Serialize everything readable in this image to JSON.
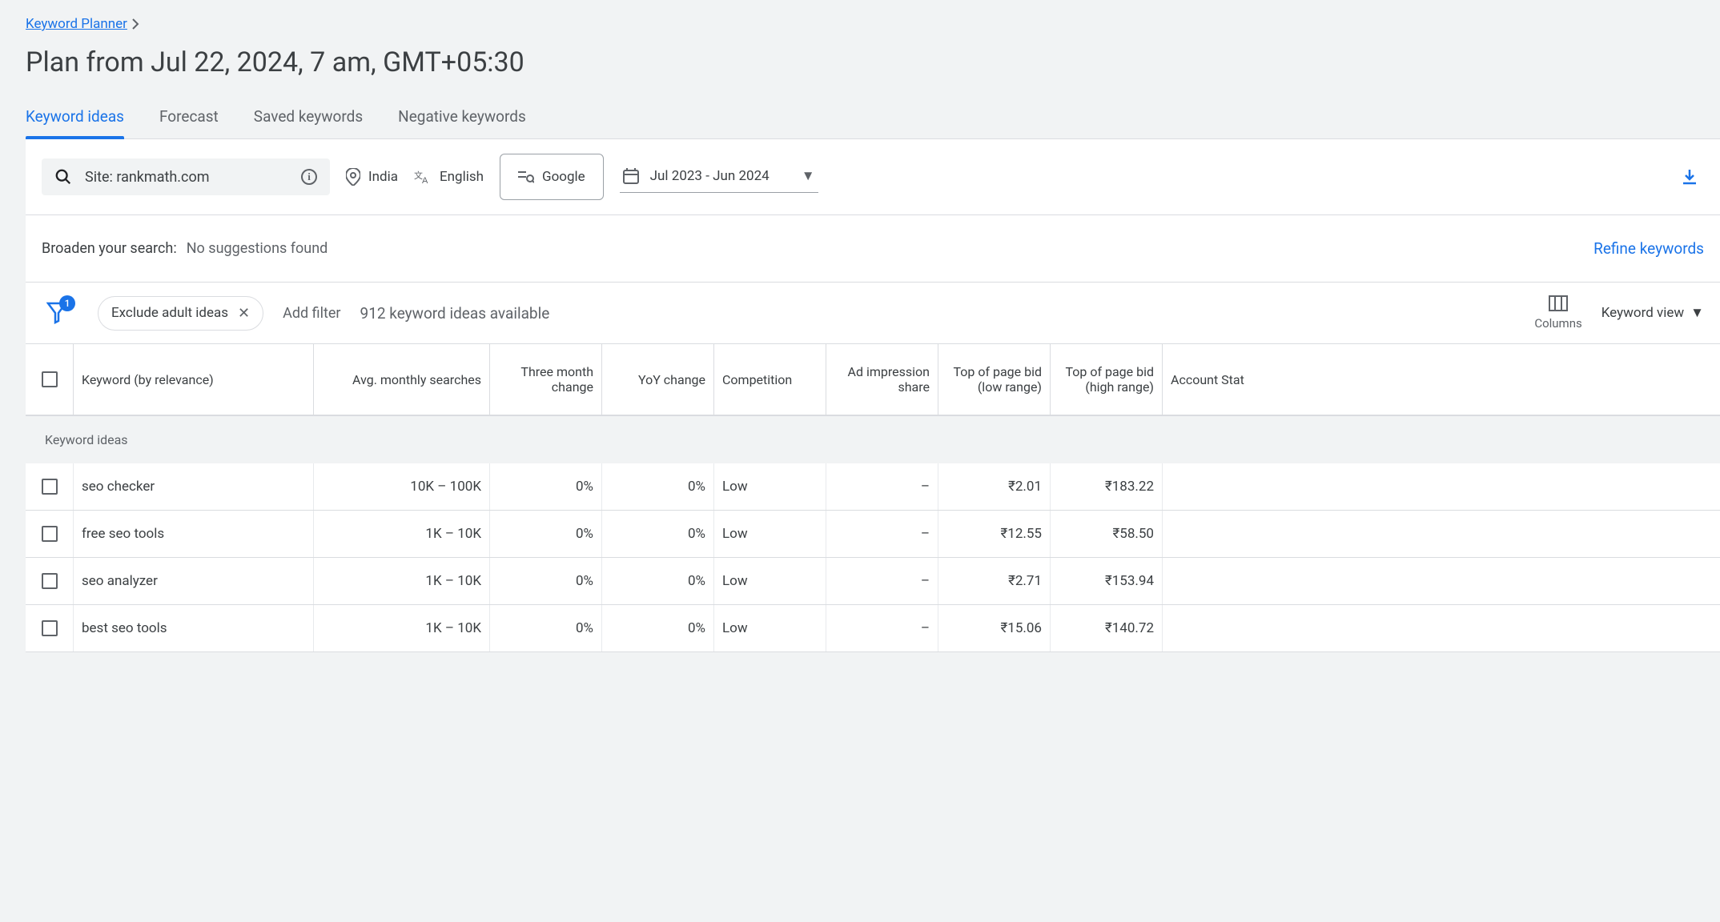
{
  "breadcrumb": {
    "label": "Keyword Planner"
  },
  "page_title": "Plan from Jul 22, 2024, 7 am, GMT+05:30",
  "tabs": [
    {
      "label": "Keyword ideas",
      "active": true
    },
    {
      "label": "Forecast"
    },
    {
      "label": "Saved keywords"
    },
    {
      "label": "Negative keywords"
    }
  ],
  "filters": {
    "site": "Site: rankmath.com",
    "location": "India",
    "language": "English",
    "network": "Google",
    "date_range": "Jul 2023 - Jun 2024"
  },
  "broaden": {
    "label": "Broaden your search:",
    "value": "No suggestions found"
  },
  "refine_label": "Refine keywords",
  "toolbar": {
    "filter_badge": "1",
    "pill_label": "Exclude adult ideas",
    "add_filter": "Add filter",
    "ideas_count": "912 keyword ideas available",
    "columns_label": "Columns",
    "view_label": "Keyword view"
  },
  "columns": {
    "keyword": "Keyword (by relevance)",
    "avg": "Avg. monthly searches",
    "three_month": "Three month change",
    "yoy": "YoY change",
    "competition": "Competition",
    "ad_share": "Ad impression share",
    "bid_low": "Top of page bid (low range)",
    "bid_high": "Top of page bid (high range)",
    "account_stat": "Account Stat"
  },
  "subheader": "Keyword ideas",
  "rows": [
    {
      "keyword": "seo checker",
      "avg": "10K – 100K",
      "three_month": "0%",
      "yoy": "0%",
      "competition": "Low",
      "ad_share": "–",
      "bid_low": "₹2.01",
      "bid_high": "₹183.22"
    },
    {
      "keyword": "free seo tools",
      "avg": "1K – 10K",
      "three_month": "0%",
      "yoy": "0%",
      "competition": "Low",
      "ad_share": "–",
      "bid_low": "₹12.55",
      "bid_high": "₹58.50"
    },
    {
      "keyword": "seo analyzer",
      "avg": "1K – 10K",
      "three_month": "0%",
      "yoy": "0%",
      "competition": "Low",
      "ad_share": "–",
      "bid_low": "₹2.71",
      "bid_high": "₹153.94"
    },
    {
      "keyword": "best seo tools",
      "avg": "1K – 10K",
      "three_month": "0%",
      "yoy": "0%",
      "competition": "Low",
      "ad_share": "–",
      "bid_low": "₹15.06",
      "bid_high": "₹140.72"
    }
  ]
}
